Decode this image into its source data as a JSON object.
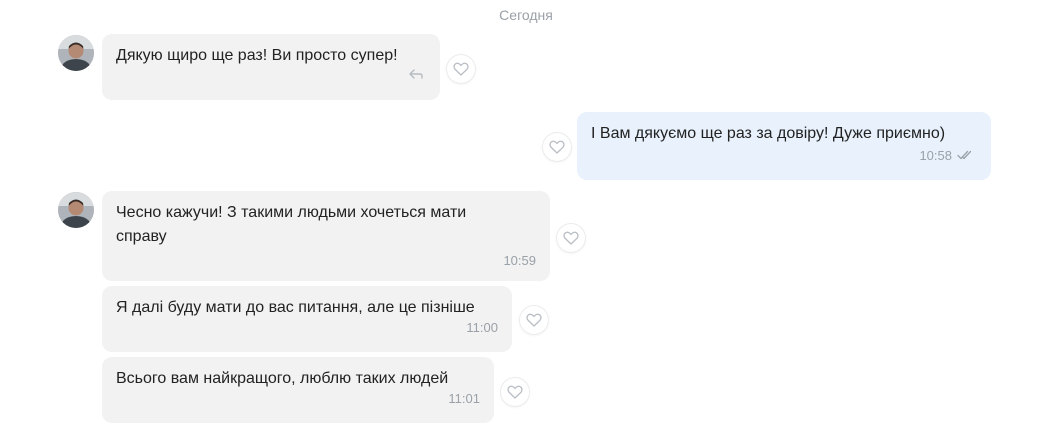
{
  "date_separator": "Сегодня",
  "messages": [
    {
      "direction": "in",
      "text": "Дякую щиро ще раз! Ви просто супер!",
      "time": "",
      "status_icon": "reply-icon"
    },
    {
      "direction": "out",
      "text": "І Вам дякуємо ще раз за довіру! Дуже приємно)",
      "time": "10:58",
      "status_icon": "double-check-icon"
    },
    {
      "direction": "in",
      "text": "Чесно кажучи! З такими людьми хочеться мати справу",
      "time": "10:59"
    },
    {
      "direction": "in",
      "text": "Я далі буду мати до вас питання, але це пізніше",
      "time": "11:00"
    },
    {
      "direction": "in",
      "text": "Всього вам найкращого, люблю таких людей",
      "time": "11:01"
    }
  ],
  "colors": {
    "incoming_bubble": "#f2f2f2",
    "outgoing_bubble": "#e8f1fc",
    "meta_text": "#9aa1a8"
  }
}
